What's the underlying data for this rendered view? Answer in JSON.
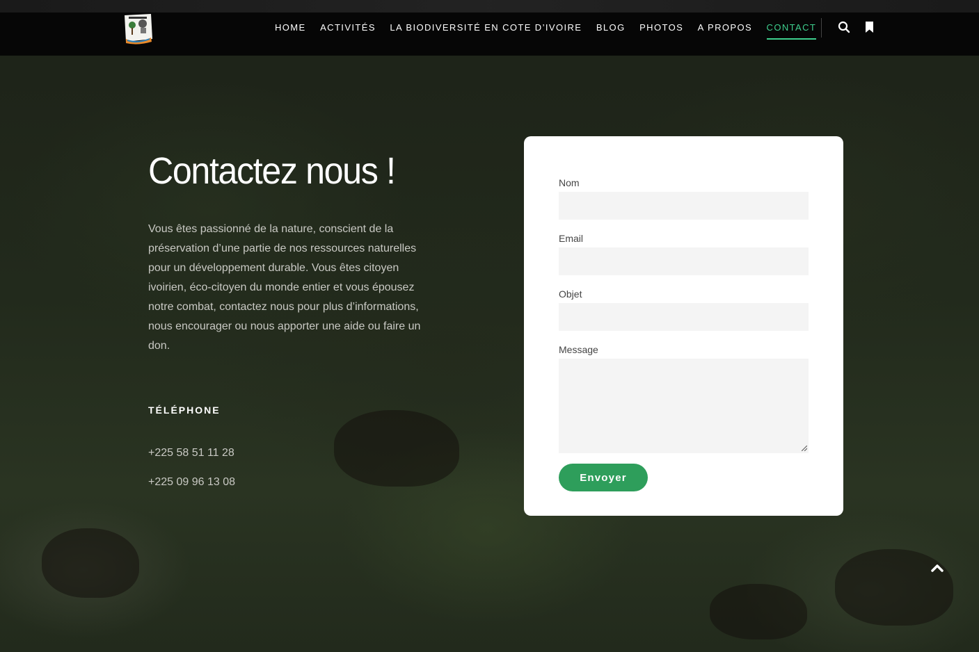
{
  "header": {
    "nav": [
      {
        "label": "HOME",
        "active": false
      },
      {
        "label": "ACTIVITÉS",
        "active": false
      },
      {
        "label": "LA BIODIVERSITÉ EN COTE D’IVOIRE",
        "active": false
      },
      {
        "label": "BLOG",
        "active": false
      },
      {
        "label": "PHOTOS",
        "active": false
      },
      {
        "label": "A PROPOS",
        "active": false
      },
      {
        "label": "CONTACT",
        "active": true
      }
    ],
    "icons": [
      "search-icon",
      "bookmark-icon"
    ],
    "accent_color": "#3ecf8e"
  },
  "contact": {
    "title": "Contactez nous !",
    "intro": "Vous êtes passionné de la nature, conscient de la préservation d’une partie de nos ressources naturelles pour un développement durable. Vous êtes citoyen ivoirien, éco-citoyen du monde entier et vous épousez notre combat, contactez nous pour plus d’informations, nous encourager ou nous apporter une aide ou faire un don.",
    "phone_label": "TÉLÉPHONE",
    "phones": [
      "+225 58 51 11 28",
      "+225 09 96 13 08"
    ]
  },
  "form": {
    "name_label": "Nom",
    "email_label": "Email",
    "subject_label": "Objet",
    "message_label": "Message",
    "name_value": "",
    "email_value": "",
    "subject_value": "",
    "message_value": "",
    "submit_label": "Envoyer",
    "submit_color": "#2e9e5b"
  }
}
